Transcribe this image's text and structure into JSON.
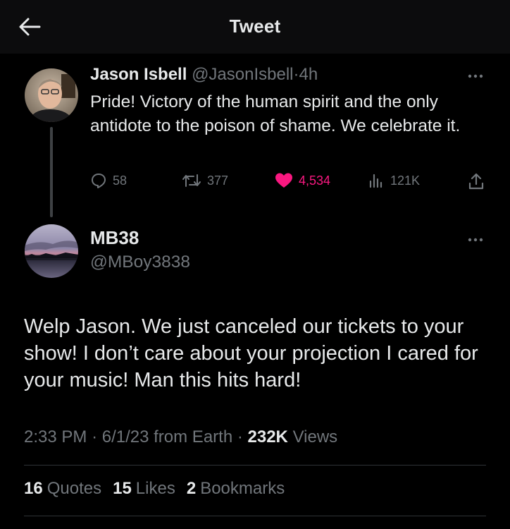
{
  "header": {
    "title": "Tweet"
  },
  "parent_tweet": {
    "name": "Jason Isbell",
    "handle": "@JasonIsbell",
    "separator": "·",
    "time": "4h",
    "text": "Pride! Victory of the human spirit and the only antidote to the poison of shame. We celebrate it.",
    "replies": "58",
    "retweets": "377",
    "likes": "4,534",
    "views": "121K",
    "liked": true
  },
  "reply_tweet": {
    "name": "MB38",
    "handle": "@MBoy3838",
    "text": "Welp Jason. We just canceled our tickets to your show! I don’t care about your projection I cared for your music! Man this hits hard!",
    "time": "2:33 PM",
    "date": "6/1/23",
    "source": "from Earth",
    "separator": "·",
    "views_count": "232K",
    "views_label": "Views"
  },
  "stats": [
    {
      "count": "16",
      "label": "Quotes"
    },
    {
      "count": "15",
      "label": "Likes"
    },
    {
      "count": "2",
      "label": "Bookmarks"
    }
  ],
  "colors": {
    "background": "#000000",
    "text_primary": "#e7e9ea",
    "text_muted": "#71767b",
    "like_pink": "#f91880",
    "divider": "#2f3336"
  },
  "icons": [
    "back-arrow-icon",
    "more-icon",
    "reply-icon",
    "retweet-icon",
    "heart-icon",
    "views-icon",
    "share-icon"
  ]
}
